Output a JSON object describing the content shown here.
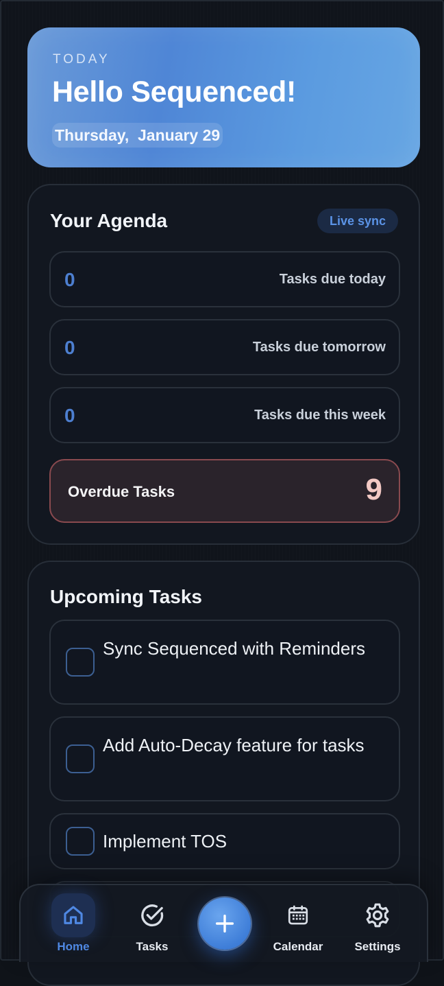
{
  "hero": {
    "eyebrow": "TODAY",
    "title": "Hello Sequenced!",
    "date": "Thursday,  January 29"
  },
  "agenda": {
    "title": "Your Agenda",
    "badge": "Live sync",
    "stats": [
      {
        "count": "0",
        "label": "Tasks due today"
      },
      {
        "count": "0",
        "label": "Tasks due tomorrow"
      },
      {
        "count": "0",
        "label": "Tasks due this week"
      }
    ],
    "overdue": {
      "label": "Overdue Tasks",
      "count": "9"
    }
  },
  "upcoming": {
    "title": "Upcoming Tasks",
    "tasks": [
      {
        "text": "Sync Sequenced with Reminders",
        "done": false
      },
      {
        "text": "Add Auto-Decay feature for tasks",
        "done": false
      },
      {
        "text": "Implement TOS",
        "done": false
      }
    ]
  },
  "tabbar": {
    "tabs": [
      {
        "label": "Home",
        "icon": "home-icon",
        "active": true
      },
      {
        "label": "Tasks",
        "icon": "check-circle-icon",
        "active": false
      },
      {
        "label": "Calendar",
        "icon": "calendar-icon",
        "active": false
      },
      {
        "label": "Settings",
        "icon": "gear-icon",
        "active": false
      }
    ],
    "fab_icon": "plus-icon"
  },
  "colors": {
    "accent": "#4f88e3",
    "hero_gradient_start": "#6a9ad8",
    "hero_gradient_end": "#67a6e3",
    "overdue_border": "#8a4a4f",
    "overdue_count": "#f3c9c4",
    "background": "#10141b"
  }
}
